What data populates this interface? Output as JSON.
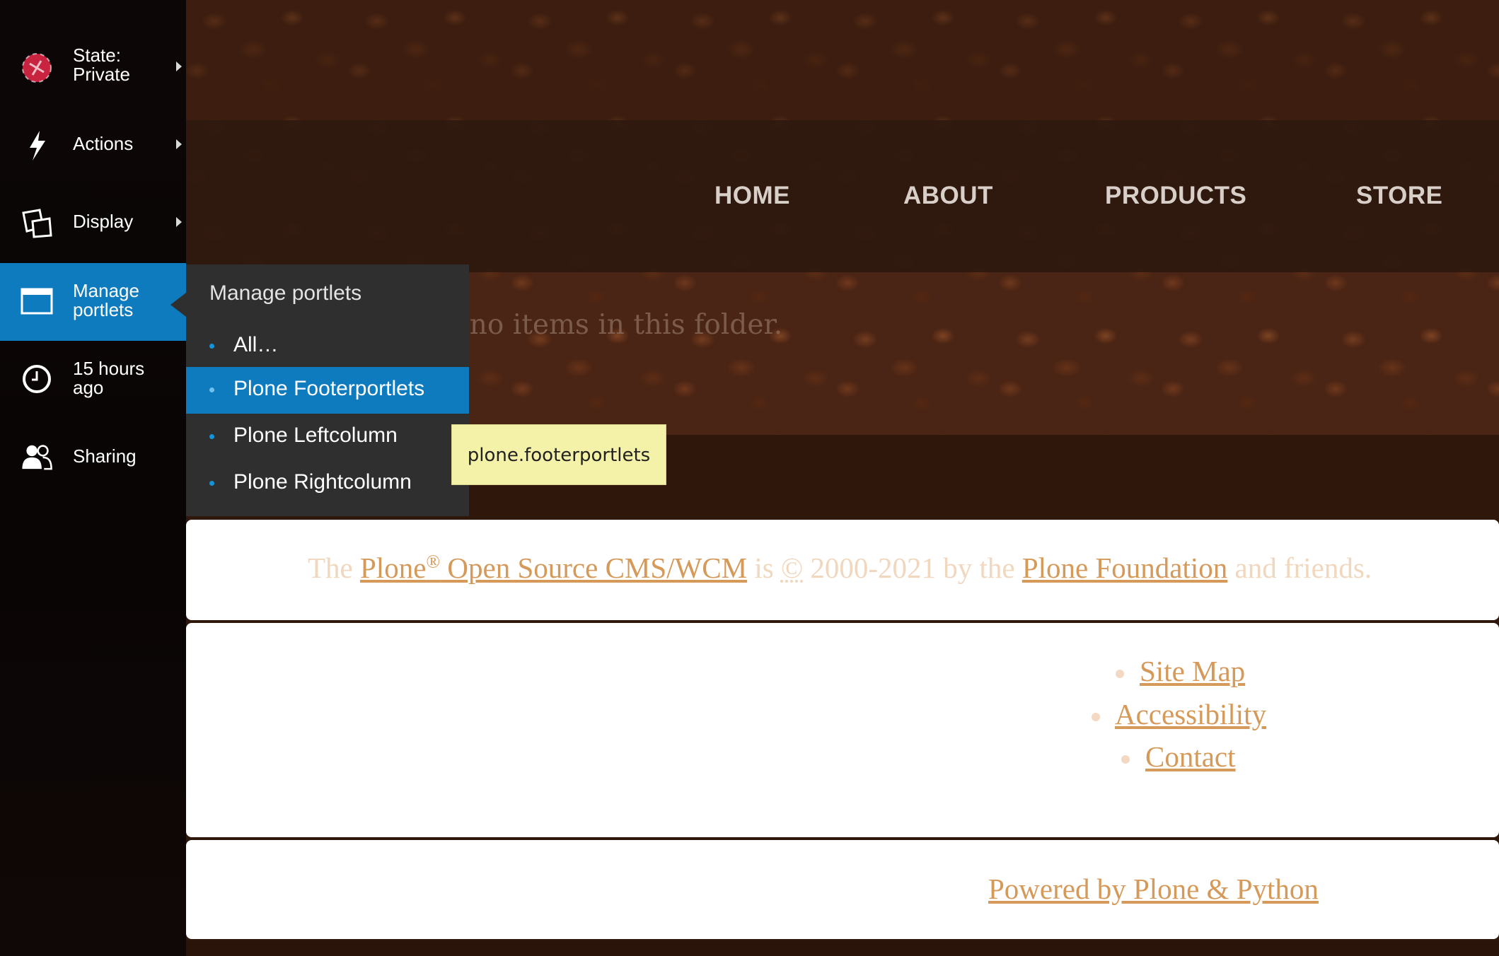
{
  "navigation": {
    "items": [
      "HOME",
      "ABOUT",
      "PRODUCTS",
      "STORE"
    ]
  },
  "content": {
    "empty_message": "There are currently no items in this folder."
  },
  "toolbar": {
    "state_label": "State:",
    "state_value": "Private",
    "actions": "Actions",
    "display": "Display",
    "manage_line1": "Manage",
    "manage_line2": "portlets",
    "modified_line1": "15 hours",
    "modified_line2": "ago",
    "sharing": "Sharing"
  },
  "submenu": {
    "title": "Manage portlets",
    "items": [
      "All…",
      "Plone Footerportlets",
      "Plone Leftcolumn",
      "Plone Rightcolumn"
    ],
    "active_index": 1
  },
  "tooltip": "plone.footerportlets",
  "footer": {
    "copy_pre": "The ",
    "plone": "Plone",
    "registered": "®",
    "cms": " Open Source CMS/WCM",
    "copy_mid": " is ",
    "copyright_symbol": "©",
    "copy_years": " 2000-2021 by the ",
    "foundation": "Plone Foundation",
    "copy_post": " and friends.",
    "links": [
      "Site Map",
      "Accessibility",
      "Contact"
    ],
    "powered": "Powered by Plone & Python"
  },
  "colors": {
    "accent": "#0f7bbf",
    "link": "#d5995a",
    "tooltip_bg": "#f4f1a8"
  }
}
